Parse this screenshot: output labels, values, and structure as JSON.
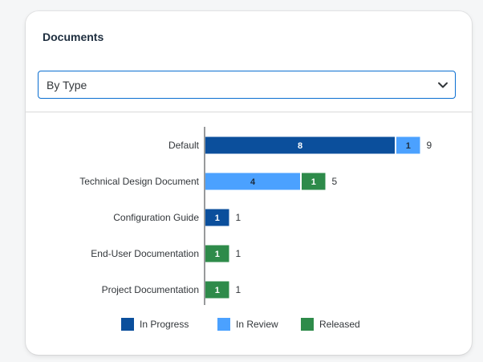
{
  "card": {
    "title": "Documents"
  },
  "filter": {
    "selected": "By Type"
  },
  "icons": {
    "dropdown": "chevron-down-icon"
  },
  "colors": {
    "in_progress": "#0b4f9c",
    "in_review": "#4ba1ff",
    "released": "#2e8b4a",
    "accent": "#0a6ed1"
  },
  "chart_data": {
    "type": "bar",
    "orientation": "horizontal",
    "stacked": true,
    "categories": [
      "Default",
      "Technical Design Document",
      "Configuration Guide",
      "End-User Documentation",
      "Project Documentation"
    ],
    "series": [
      {
        "name": "In Progress",
        "values": [
          8,
          0,
          1,
          0,
          0
        ]
      },
      {
        "name": "In Review",
        "values": [
          1,
          4,
          0,
          0,
          0
        ]
      },
      {
        "name": "Released",
        "values": [
          0,
          1,
          0,
          1,
          1
        ]
      }
    ],
    "totals": [
      9,
      5,
      1,
      1,
      1
    ],
    "legend_position": "bottom",
    "grid": false
  }
}
